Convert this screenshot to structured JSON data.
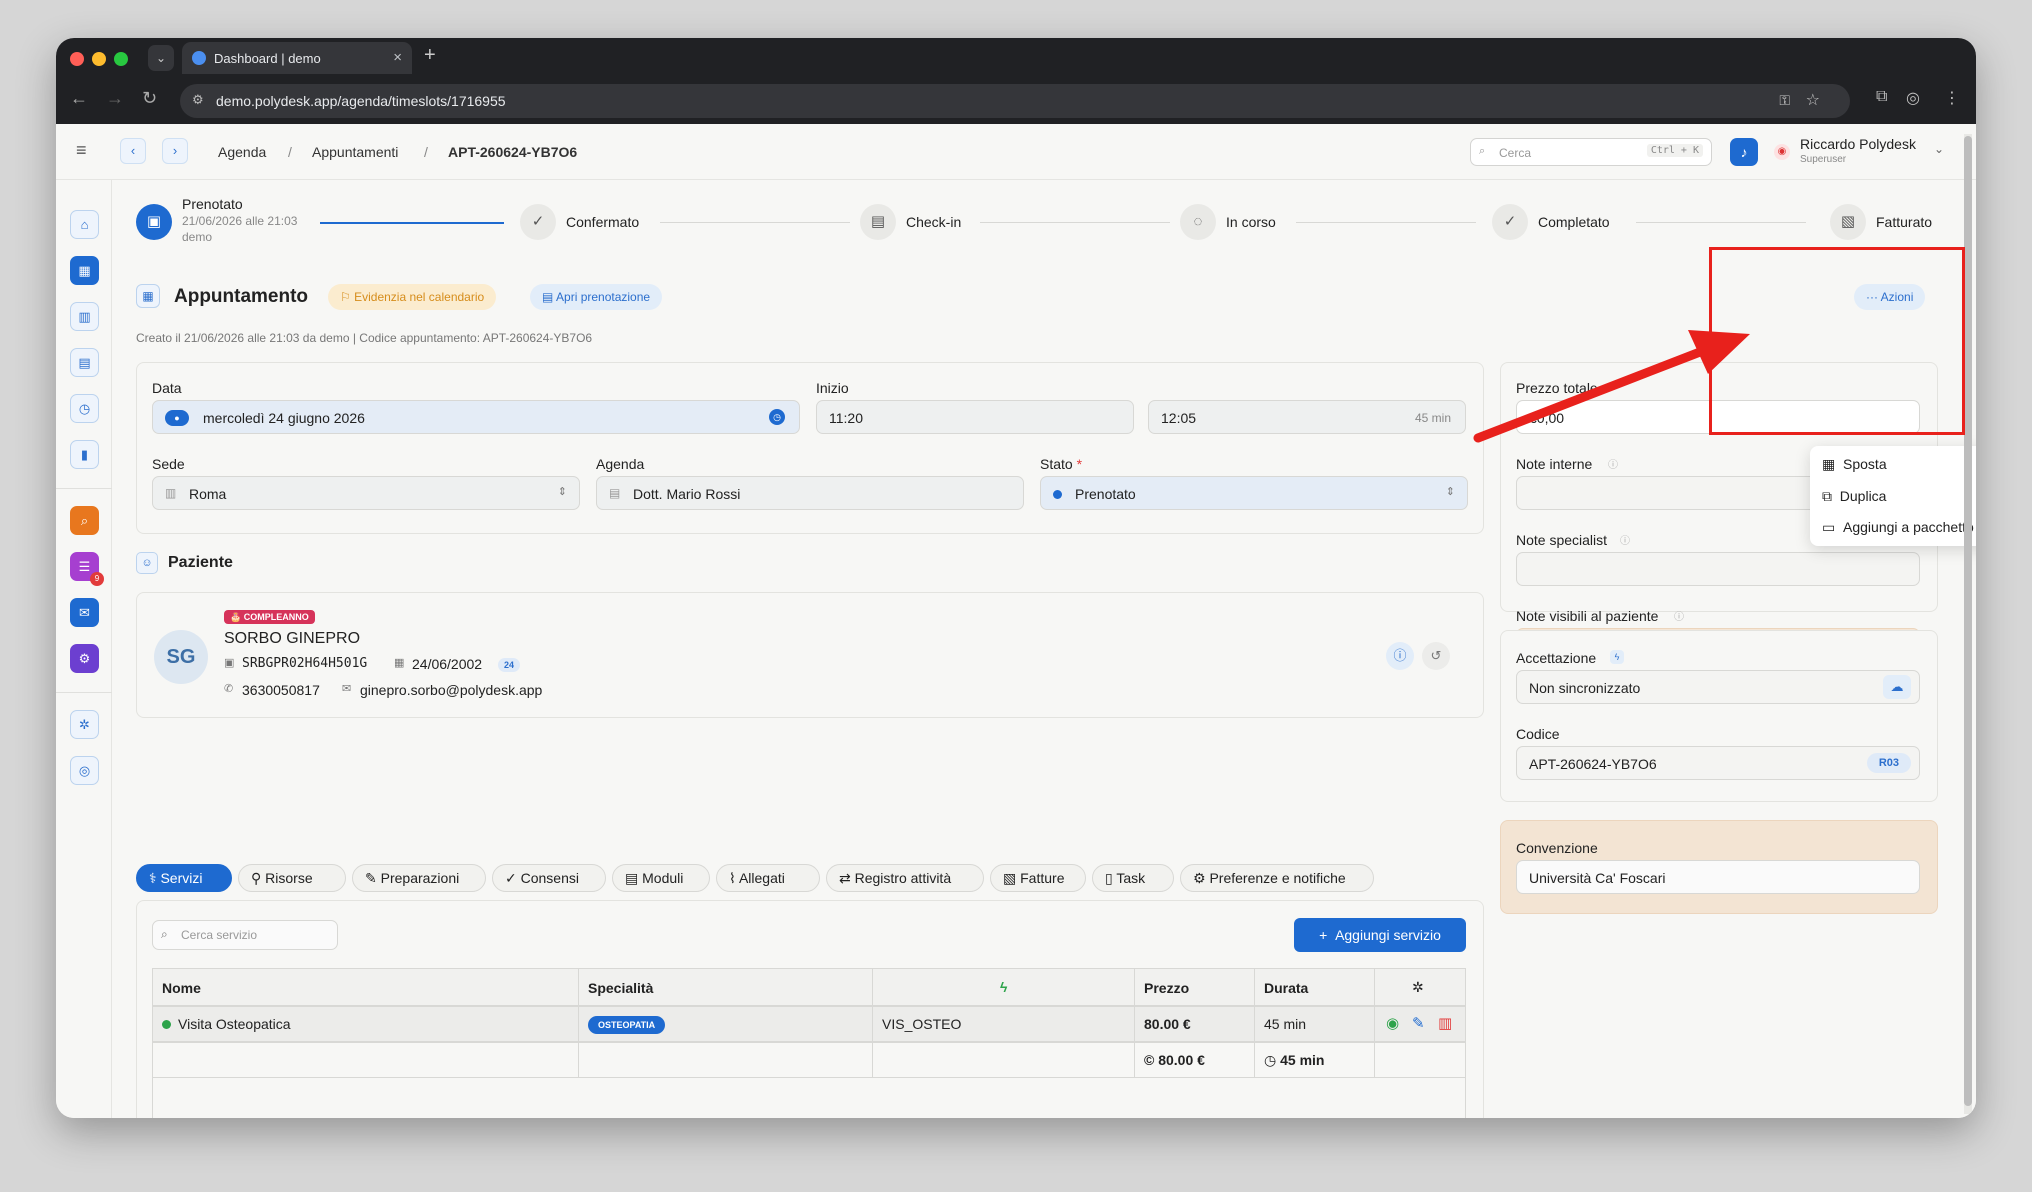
{
  "browser": {
    "tab_title": "Dashboard | demo",
    "url": "demo.polydesk.app/agenda/timeslots/1716955"
  },
  "header": {
    "breadcrumbs": [
      "Agenda",
      "/",
      "Appuntamenti",
      "/",
      "APT-260624-YB7O6"
    ],
    "search_placeholder": "Cerca",
    "search_shortcut": "Ctrl + K",
    "user_name": "Riccardo Polydesk",
    "user_role": "Superuser"
  },
  "sidebar": {
    "badge_count": "9"
  },
  "steps": {
    "step1_label": "Prenotato",
    "step1_date": "21/06/2026 alle 21:03",
    "step1_by": "demo",
    "step2_label": "Confermato",
    "step3_label": "Check-in",
    "step4_label": "In corso",
    "step5_label": "Completato",
    "step6_label": "Fatturato"
  },
  "appointment": {
    "title": "Appuntamento",
    "highlight_label": "Evidenzia nel calendario",
    "open_booking_label": "Apri prenotazione",
    "actions_label": "Azioni",
    "meta": "Creato il 21/06/2026 alle 21:03 da demo | Codice appuntamento: APT-260624-YB7O6"
  },
  "actions_menu": {
    "move": "Sposta",
    "duplicate": "Duplica",
    "add_package": "Aggiungi a pacchetto"
  },
  "form": {
    "date_label": "Data",
    "date_value": "mercoledì 24 giugno 2026",
    "start_label": "Inizio",
    "start_value": "11:20",
    "end_value": "12:05",
    "duration_hint": "45 min",
    "site_label": "Sede",
    "site_value": "Roma",
    "agenda_label": "Agenda",
    "agenda_value": "Dott. Mario Rossi",
    "status_label": "Stato",
    "status_required": "*",
    "status_value": "Prenotato",
    "total_price_label": "Prezzo totale",
    "total_price_value": "€0,00",
    "internal_notes_label": "Note interne",
    "specialist_notes_label": "Note specialist",
    "patient_notes_label": "Note visibili al paziente"
  },
  "patient": {
    "section_title": "Paziente",
    "birthday_badge": "COMPLEANNO",
    "initials": "SG",
    "name": "SORBO GINEPRO",
    "fiscal_code": "SRBGPR02H64H501G",
    "birth_date": "24/06/2002",
    "age": "24",
    "phone": "3630050817",
    "email": "ginepro.sorbo@polydesk.app"
  },
  "tabs": [
    "Servizi",
    "Risorse",
    "Preparazioni",
    "Consensi",
    "Moduli",
    "Allegati",
    "Registro attività",
    "Fatture",
    "Task",
    "Preferenze e notifiche"
  ],
  "services": {
    "search_placeholder": "Cerca servizio",
    "add_button": "Aggiungi servizio",
    "columns": [
      "Nome",
      "Specialità",
      "",
      "Prezzo",
      "Durata"
    ],
    "row": {
      "name": "Visita Osteopatica",
      "specialty": "OSTEOPATIA",
      "code": "VIS_OSTEO",
      "price": "80.00 €",
      "duration": "45 min"
    },
    "total_price": "80.00 €",
    "total_duration": "45 min"
  },
  "acceptance": {
    "label": "Accettazione",
    "value": "Non sincronizzato",
    "code_label": "Codice",
    "code_value": "APT-260624-YB7O6",
    "code_badge": "R03"
  },
  "convention": {
    "label": "Convenzione",
    "value": "Università Ca' Foscari"
  }
}
